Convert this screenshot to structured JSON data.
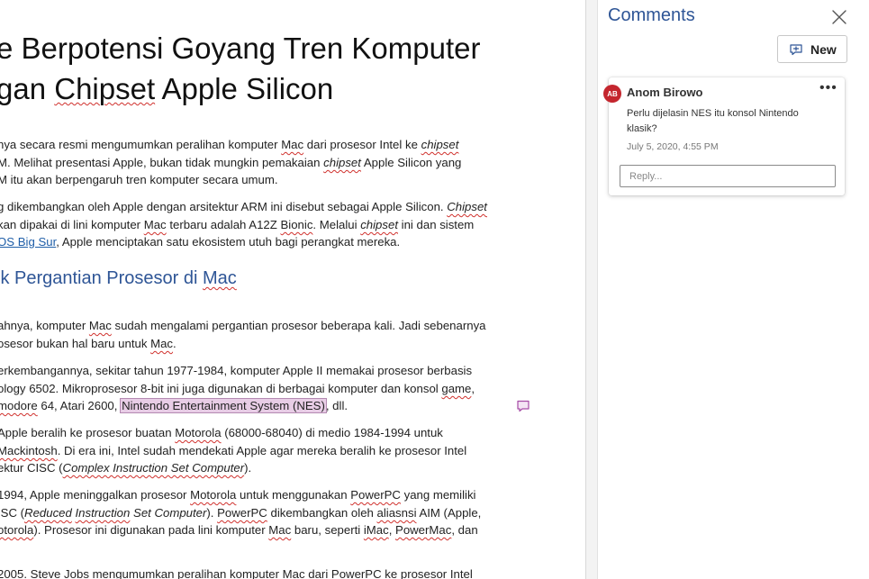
{
  "document": {
    "title_line1": "e Berpotensi Goyang Tren Komputer",
    "title_line2_a": "gan ",
    "title_line2_b": "Chipset",
    "title_line2_c": " Apple Silicon",
    "p1_l1_a": "nya secara resmi mengumumkan peralihan komputer ",
    "p1_l1_b": "Mac",
    "p1_l1_c": " dari prosesor Intel ke ",
    "p1_l1_d": "chipset",
    "p1_l2_a": "M. Melihat presentasi Apple, bukan tidak mungkin pemakaian ",
    "p1_l2_b": "chipset",
    "p1_l2_c": " Apple Silicon yang",
    "p1_l3": "M itu akan berpengaruh tren komputer secara umum.",
    "p2_l1_a": "g dikembangkan oleh Apple dengan arsitektur ARM ini disebut sebagai Apple Silicon. ",
    "p2_l1_b": "Chipset",
    "p2_l2_a": "kan dipakai di lini komputer ",
    "p2_l2_b": "Mac",
    "p2_l2_c": " terbaru adalah A12Z ",
    "p2_l2_d": "Bionic",
    "p2_l2_e": ". Melalui ",
    "p2_l2_f": "chipset",
    "p2_l2_g": " ini dan sistem",
    "p2_l3_link": "OS Big Sur",
    "p2_l3_b": ", Apple menciptakan satu ekosistem utuh bagi perangkat mereka.",
    "heading_a": "ik Pergantian Prosesor di ",
    "heading_b": "Mac",
    "p3_l1_a": "ahnya, komputer ",
    "p3_l1_b": "Mac",
    "p3_l1_c": " sudah mengalami pergantian prosesor beberapa kali. Jadi sebenarnya",
    "p3_l2_a": "osesor bukan hal baru untuk ",
    "p3_l2_b": "Mac",
    "p3_l2_c": ".",
    "p4_l1": "erkembangannya, sekitar tahun 1977-1984, komputer Apple II memakai prosesor berbasis",
    "p4_l2_a": "ology 6502. Mikroprosesor 8-bit ini juga digunakan di berbagai komputer dan konsol ",
    "p4_l2_b": "game",
    "p4_l2_c": ",",
    "p4_l3_a": "modore",
    "p4_l3_b": " 64, Atari 2600, ",
    "p4_l3_hl": "Nintendo Entertainment System (NES)",
    "p4_l3_c": ", dll.",
    "p5_l1_a": "Apple beralih ke prosesor buatan ",
    "p5_l1_b": "Motorola",
    "p5_l1_c": " (68000-68040) di medio 1984-1994 untuk",
    "p5_l2_a": "Mackintosh",
    "p5_l2_b": ". Di era ini, Intel sudah mendekati Apple agar mereka beralih ke prosesor Intel",
    "p5_l3_a": "ektur CISC (",
    "p5_l3_b": "Complex Instruction Set Computer",
    "p5_l3_c": ").",
    "p6_l1_a": "1994, Apple meninggalkan prosesor ",
    "p6_l1_b": "Motorola",
    "p6_l1_c": " untuk menggunakan ",
    "p6_l1_d": "PowerPC",
    "p6_l1_e": " yang memiliki",
    "p6_l2_a": "ISC (",
    "p6_l2_b": "Reduced",
    "p6_l2_c": " ",
    "p6_l2_d": "Instruction",
    "p6_l2_e": " Set Computer",
    "p6_l2_f": "). ",
    "p6_l2_g": "PowerPC",
    "p6_l2_h": " dikembangkan oleh ",
    "p6_l2_i": "aliasnsi",
    "p6_l2_j": " AIM (Apple,",
    "p6_l3_a": "otorola",
    "p6_l3_b": "). Prosesor ini digunakan pada lini komputer ",
    "p6_l3_c": "Mac",
    "p6_l3_d": " baru, seperti ",
    "p6_l3_e": "iMac",
    "p6_l3_f": ", ",
    "p6_l3_g": "PowerMac",
    "p6_l3_h": ", dan",
    "p7_l1": "2005. Steve Jobs mengumumkan peralihan komputer Mac dari PowerPC ke prosesor Intel"
  },
  "comments_pane": {
    "title": "Comments",
    "close_icon": "close-icon",
    "new_button_label": "New",
    "comment": {
      "avatar_initials": "AB",
      "avatar_color": "#c4262e",
      "author": "Anom Birowo",
      "more_label": "•••",
      "text": "Perlu dijelasin NES itu konsol Nintendo klasik?",
      "date": "July 5, 2020, 4:55 PM",
      "reply_placeholder": "Reply..."
    }
  },
  "colors": {
    "heading_blue": "#2e5596",
    "highlight": "#e8cde6",
    "comment_marker": "#a64ca6"
  }
}
